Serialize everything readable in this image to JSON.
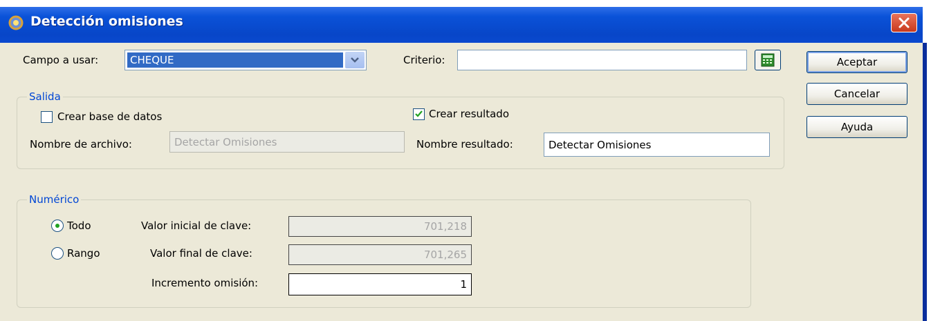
{
  "window": {
    "title": "Detección omisiones",
    "app_icon": "gear-app-icon",
    "close_icon": "close-icon"
  },
  "campo": {
    "label": "Campo a usar:",
    "value": "CHEQUE"
  },
  "criterio": {
    "label": "Criterio:",
    "value": ""
  },
  "buttons": {
    "aceptar": "Aceptar",
    "cancelar": "Cancelar",
    "ayuda": "Ayuda"
  },
  "salida": {
    "legend": "Salida",
    "crear_base": {
      "label": "Crear base de datos",
      "checked": false
    },
    "crear_resultado": {
      "label": "Crear resultado",
      "checked": true
    },
    "nombre_archivo": {
      "label": "Nombre de archivo:",
      "value": "Detectar Omisiones"
    },
    "nombre_resultado": {
      "label": "Nombre resultado:",
      "value": "Detectar Omisiones"
    }
  },
  "numerico": {
    "legend": "Numérico",
    "todo": {
      "label": "Todo",
      "selected": true
    },
    "rango": {
      "label": "Rango",
      "selected": false
    },
    "valor_inicial": {
      "label": "Valor inicial de clave:",
      "value": "701,218"
    },
    "valor_final": {
      "label": "Valor final de clave:",
      "value": "701,265"
    },
    "incremento": {
      "label": "Incremento omisión:",
      "value": "1"
    }
  },
  "colors": {
    "titlebar": "#0a52d8",
    "group_legend": "#0046d5",
    "selection": "#316ac5",
    "dialog_bg": "#ece9d8"
  }
}
